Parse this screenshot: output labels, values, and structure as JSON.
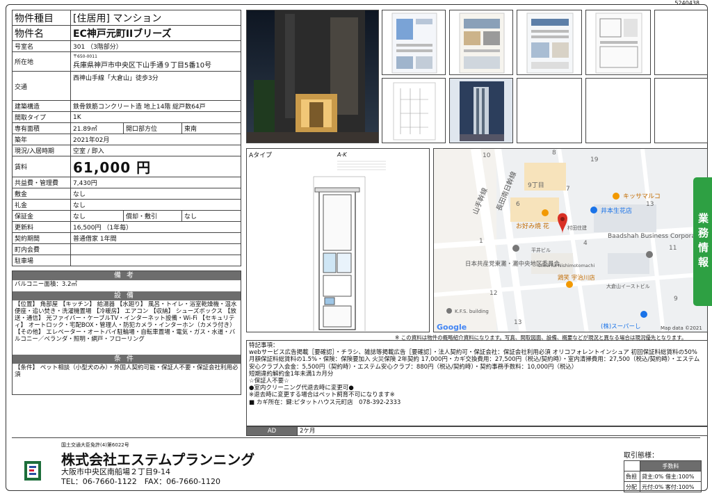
{
  "doc_id": "5240438",
  "spec": {
    "type_label": "物件種目",
    "type_value": "[住居用] マンション",
    "name_label": "物件名",
    "name_value": "EC神戸元町IIブリーズ",
    "room_label": "号室名",
    "room_value": "301 （3階部分）",
    "address_label": "所在地",
    "postal": "〒650-0011",
    "address_value": "兵庫県神戸市中央区下山手通９丁目5番10号",
    "traffic_label": "交通",
    "traffic_value": "西神山手線「大倉山」徒歩3分",
    "structure_label": "建築構造",
    "structure_value": "鉄骨鉄筋コンクリート造 地上14階 総戸数64戸",
    "layout_label": "間取タイプ",
    "layout_value": "1K",
    "area_label": "専有面積",
    "area_value": "21.89㎡",
    "direction_label": "開口部方位",
    "direction_value": "東南",
    "built_label": "築年",
    "built_value": "2021年02月",
    "status_label": "現況/入居時期",
    "status_value": "空室 / 即入",
    "rent_label": "賃料",
    "rent_value": "61,000 円",
    "fee_label": "共益費・管理費",
    "fee_value": "7,430円",
    "deposit_label": "敷金",
    "deposit_value": "なし",
    "keymoney_label": "礼金",
    "keymoney_value": "なし",
    "guarantee_label": "保証金",
    "guarantee_value": "なし",
    "amort_label": "償却・敷引",
    "amort_value": "なし",
    "renewal_label": "更新料",
    "renewal_value": "16,500円 （1年毎）",
    "contract_label": "契約期間",
    "contract_value": "普通借家 1年間",
    "council_label": "町内会費",
    "council_value": "",
    "parking_label": "駐車場",
    "parking_value": ""
  },
  "notes": {
    "remarks_header": "備考",
    "remarks_text": "バルコニー面積：3.2㎡",
    "facilities_header": "設備",
    "facilities_text": "【位置】 角部屋 【キッチン】 給湯器 【水廻り】 風呂・トイレ・浴室乾燥機・温水便座・追い焚き・洗濯機置場 【冷暖房】 エアコン 【収納】 シューズボックス 【放送・通信】 光ファイバー・ケーブルTV・インターネット設備・Wi-Fi 【セキュリティ】 オートロック・宅配BOX・管理人・防犯カメラ・インターホン（カメラ付き） 【その他】 エレベーター・オートバイ駐輪場・自転車置場・電気・ガス・水道・バルコニー／ベランダ・照明・網戸・フローリング",
    "conditions_header": "条件",
    "conditions_text": "【条件】 ペット相談（小型犬のみ）・外国人契約可能・保証人不要・保証会社利用必須"
  },
  "plan": {
    "label": "Aタイプ",
    "type_label": "A-K"
  },
  "map": {
    "labels": [
      "10",
      "8",
      "19",
      "9丁目",
      "7",
      "6",
      "4",
      "13",
      "1",
      "12",
      "11",
      "13",
      "9"
    ],
    "places": {
      "kissamaruko": "キッサマルコ",
      "imoto": "井本生花店",
      "okonomi": "お好み焼 花",
      "murata": "村田住建",
      "baadshah": "Baadshah Business Corporation (BBC)",
      "hirai": "平井ビル",
      "jcp": "日本共産党東灘・灘中央地区委員会",
      "cheerful": "cheerful Nishimotomachi",
      "ukarou": "鶏笑 宇治川店",
      "okurayama_east": "大倉山イーストビル",
      "kfs": "K.F.S. building",
      "super": "(株)スーパーし",
      "road1": "山手幹線",
      "road2": "長田南日幹線"
    },
    "google": "Google",
    "attribution": "Map data ©2021"
  },
  "disclaimer": "※ この資料は物件の概略紹介資料になります。写真、間取図面、設備、概要などが現況と異なる場合は現況優先となります。",
  "remarks_lines": [
    "特記事項：",
    "webサービス広告掲載［要確認］・チラシ、雑誌等掲載広告［要確認］・法人契約可・保証会社：保証会社利用必須 オリコフォレントインシュア 初回保証料総賃料の50% 月額保証料総賃料の1.5%・保険：保険要加入 火災保険 2年契約 17,000円・カギ交換費用：27,500円（税込/契約時）・室内清掃費用：27,500（税込/契約時）・エステム安心クラブ入会金：5,500円（契約時）・エステム安心クラブ：880円（税込/契約時）・契約事務手数料：10,000円（税込）",
    "短期違約解約金1年未満1カ月分",
    "☆保証人不要☆",
    "●室内クリーニング代退去時に変更可●",
    "※退去時に変更する場合はペット飼育不可になります※",
    "■ カギ所在：鍵:ピタットハウス元町店　078-392-2333"
  ],
  "ad": {
    "label": "AD",
    "value": "2ケ月"
  },
  "tab_text": "業務情報",
  "company": {
    "license": "国土交通大臣免許(4)第6022号",
    "name": "株式会社エステムプランニング",
    "address": "大阪市中央区南船場２丁目9-14",
    "tel_fax": "TEL：06-7660-1122　FAX：06-7660-1120"
  },
  "trade": {
    "title": "取引態様：",
    "fee_header": "手数料",
    "row1_label": "負担",
    "row1_value": "貸主:0% 借主:100%",
    "row2_label": "分配",
    "row2_value": "元付:0% 客付:100%"
  },
  "colors": {
    "accent_green": "#2ea043",
    "header_gray": "#6d6d6d",
    "map_pin": "#d93025"
  }
}
